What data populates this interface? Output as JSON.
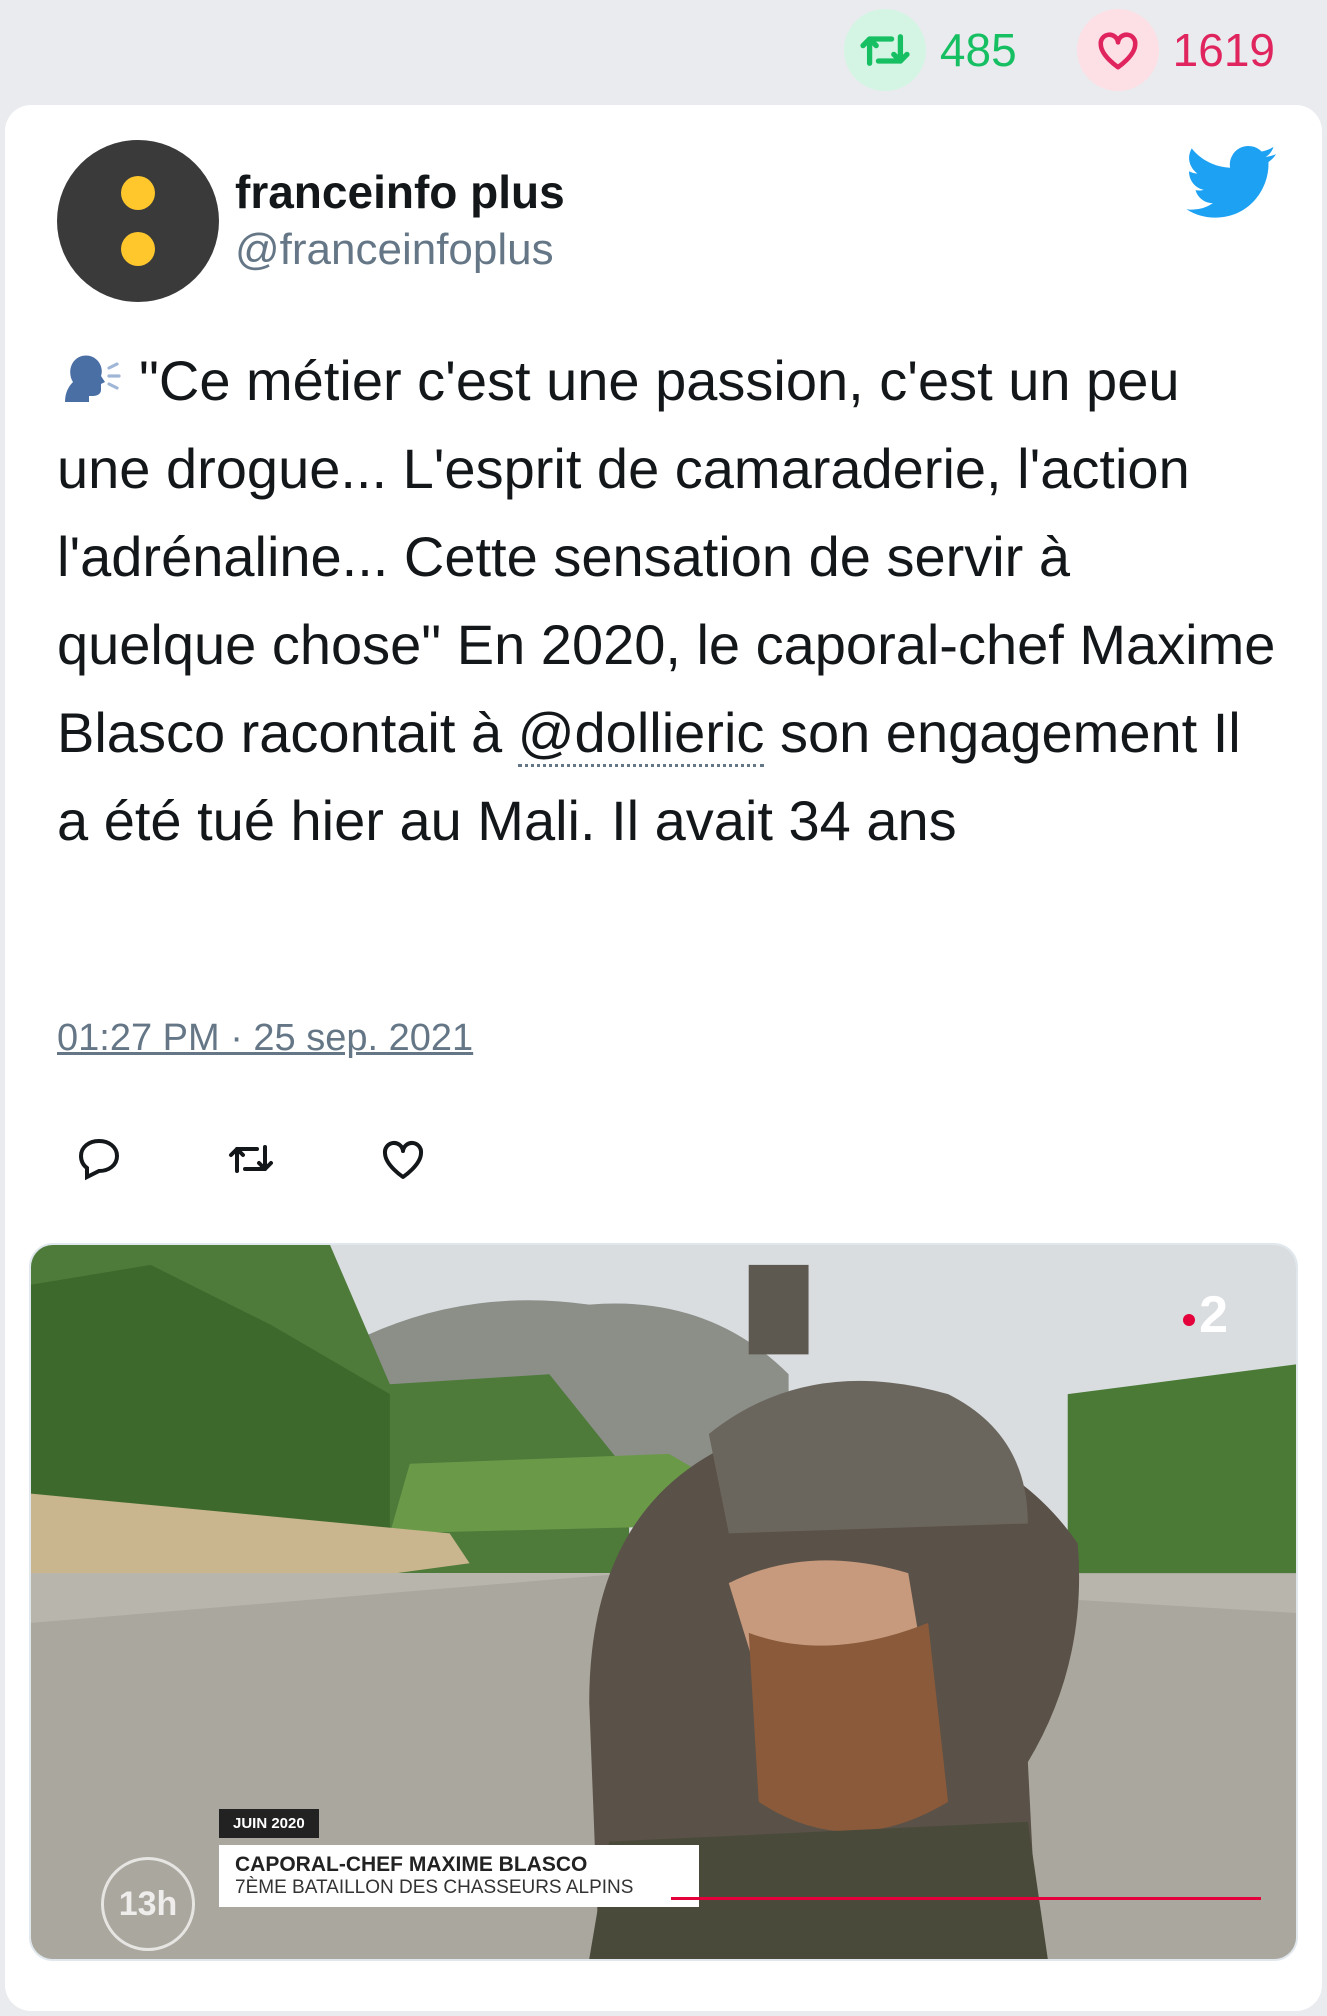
{
  "stats": {
    "retweets": "485",
    "likes": "1619"
  },
  "author": {
    "name": "franceinfo plus",
    "handle": "@franceinfoplus"
  },
  "tweet": {
    "emoji": "speaking-head",
    "text_before": "\"Ce métier c'est une passion, c'est un peu une drogue... L'esprit de camaraderie, l'action l'adrénaline... Cette sensation de servir à quelque chose\" En 2020, le caporal-chef Maxime Blasco racontait à ",
    "mention": "@dollieric",
    "text_after": " son engagement Il a été tué hier au Mali. Il avait 34 ans",
    "timestamp": "01:27 PM · 25 sep. 2021"
  },
  "media": {
    "channel_logo": "2",
    "date_tag": "JUIN 2020",
    "lower_third_name": "CAPORAL-CHEF MAXIME BLASCO",
    "lower_third_title": "7ÈME BATAILLON DES CHASSEURS ALPINS",
    "show_logo": "13h"
  },
  "colors": {
    "retweet": "#17bf63",
    "like": "#e0245e",
    "twitter": "#1da1f2",
    "muted": "#657786"
  },
  "icons": [
    "retweet-icon",
    "heart-icon",
    "twitter-bird-icon",
    "reply-icon"
  ]
}
